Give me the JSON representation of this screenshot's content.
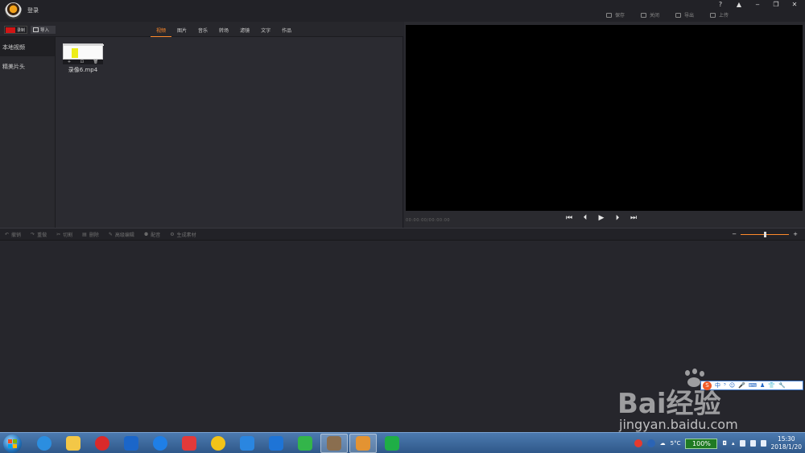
{
  "titlebar": {
    "login_label": "登录",
    "actions": [
      {
        "label": "保存",
        "icon": "save-icon"
      },
      {
        "label": "关闭",
        "icon": "close-project-icon"
      },
      {
        "label": "导出",
        "icon": "export-icon"
      },
      {
        "label": "上传",
        "icon": "upload-icon"
      }
    ],
    "window_controls": {
      "help": "?",
      "notify": "bell",
      "minimize": "‒",
      "restore": "❐",
      "close": "✕"
    }
  },
  "media": {
    "record_label": "录制",
    "import_label": "导入",
    "tabs": [
      {
        "label": "视频",
        "active": true
      },
      {
        "label": "图片",
        "active": false
      },
      {
        "label": "音乐",
        "active": false
      },
      {
        "label": "转场",
        "active": false
      },
      {
        "label": "滤镜",
        "active": false
      },
      {
        "label": "文字",
        "active": false
      },
      {
        "label": "作品",
        "active": false
      }
    ],
    "sidebar": [
      {
        "label": "本地视频",
        "active": true
      },
      {
        "label": "精美片头",
        "active": false
      }
    ],
    "clips": [
      {
        "name": "录像6.mp4",
        "tools": [
          "+",
          "⊡",
          "🗑"
        ]
      }
    ]
  },
  "preview": {
    "timecode": "00:00:00/00:00:00",
    "controls": [
      "skip-start",
      "prev-frame",
      "play",
      "next-frame",
      "skip-end"
    ]
  },
  "edit_toolbar": {
    "tools": [
      {
        "label": "撤销",
        "icon": "undo-icon"
      },
      {
        "label": "重做",
        "icon": "redo-icon"
      },
      {
        "label": "切割",
        "icon": "cut-icon"
      },
      {
        "label": "删除",
        "icon": "delete-icon"
      },
      {
        "label": "高级编辑",
        "icon": "edit-icon"
      },
      {
        "label": "配音",
        "icon": "mic-icon"
      },
      {
        "label": "生成素材",
        "icon": "generate-icon"
      }
    ],
    "zoom": {
      "minus": "−",
      "plus": "+",
      "level": 0.5
    }
  },
  "ime": {
    "items": [
      "中",
      "⁵",
      "☺",
      "🎤",
      "⌨",
      "♟",
      "👕",
      "🔧"
    ]
  },
  "watermark": {
    "logo": "Bai经验",
    "url": "jingyan.baidu.com"
  },
  "taskbar": {
    "apps": [
      "ie-icon",
      "explorer-icon",
      "netease-music-icon",
      "video-editor-icon",
      "player-icon",
      "letv-icon",
      "music-icon",
      "baidu-cloud-icon",
      "maxthon-icon",
      "media-icon",
      "photo-icon",
      "recorder-icon",
      "wps-icon"
    ],
    "tray": {
      "weather": "5°C",
      "battery": "100%",
      "time": "15:30",
      "date": "2018/1/20"
    }
  },
  "colors": {
    "accent": "#ff8a2b",
    "record_red": "#d01515",
    "bg": "#26262c"
  }
}
